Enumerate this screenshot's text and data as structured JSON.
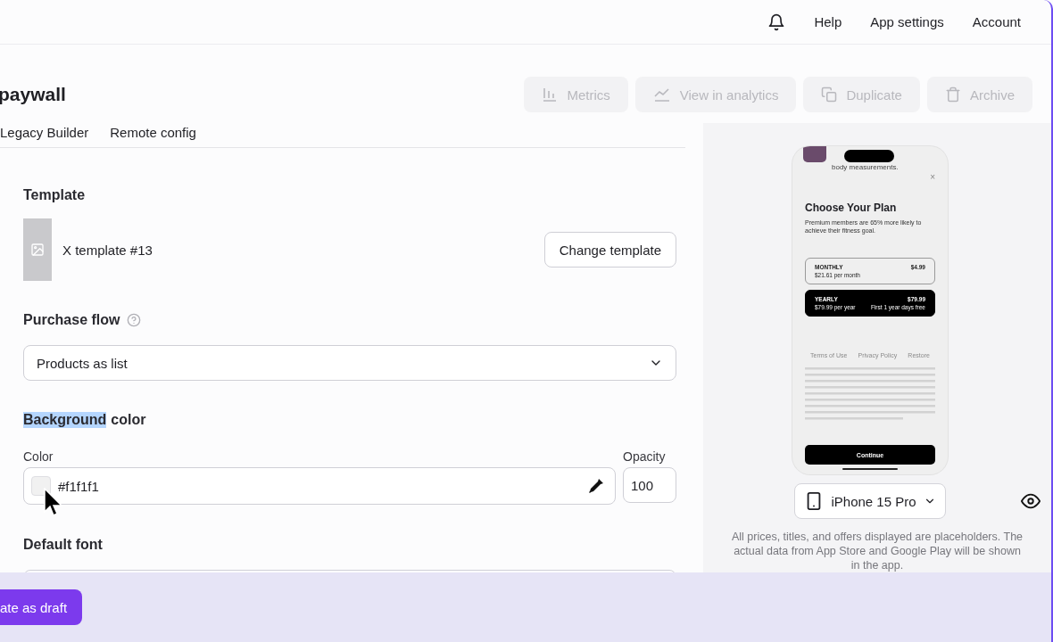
{
  "topbar": {
    "links": [
      "Help",
      "App settings",
      "Account"
    ]
  },
  "header": {
    "title": "paywall",
    "actions": [
      {
        "label": "Metrics",
        "kind": "bars",
        "disabled": true
      },
      {
        "label": "View in analytics",
        "kind": "line",
        "disabled": true
      },
      {
        "label": "Duplicate",
        "kind": "copy",
        "disabled": true
      },
      {
        "label": "Archive",
        "kind": "trash",
        "disabled": true
      }
    ]
  },
  "tabs": [
    {
      "label": "Legacy Builder",
      "selected": false
    },
    {
      "label": "Remote config",
      "selected": false
    }
  ],
  "template": {
    "heading": "Template",
    "name": "X template #13",
    "button": "Change template"
  },
  "purchase_flow": {
    "heading": "Purchase flow",
    "value": "Products as list"
  },
  "background": {
    "heading_parts": [
      {
        "text": "Background",
        "selected": true
      },
      {
        "text": "color",
        "selected": false
      }
    ],
    "color_label": "Color",
    "color_value": "#f1f1f1",
    "opacity_label": "Opacity",
    "opacity_value": "100"
  },
  "default_font": {
    "heading": "Default font"
  },
  "preview": {
    "top_text": "body measurements.",
    "close": "×",
    "title": "Choose Your Plan",
    "subtitle": "Premium members are 65% more likely to achieve their fitness goal.",
    "plans": [
      {
        "name": "MONTHLY",
        "price": "$4.99",
        "detail": "$21.61 per month",
        "selected": false
      },
      {
        "name": "YEARLY",
        "price": "$79.99",
        "detail": "$79.99 per year",
        "note": "First 1 year days free",
        "selected": true
      }
    ],
    "links": [
      "Terms of Use",
      "Privacy Policy",
      "Restore"
    ],
    "button": "Continue"
  },
  "device": {
    "label": "iPhone 15 Pro"
  },
  "note": "All prices, titles, and offers displayed are placeholders. The actual data from App Store and Google Play will be shown in the app.",
  "footer": {
    "button": "ate as draft"
  }
}
